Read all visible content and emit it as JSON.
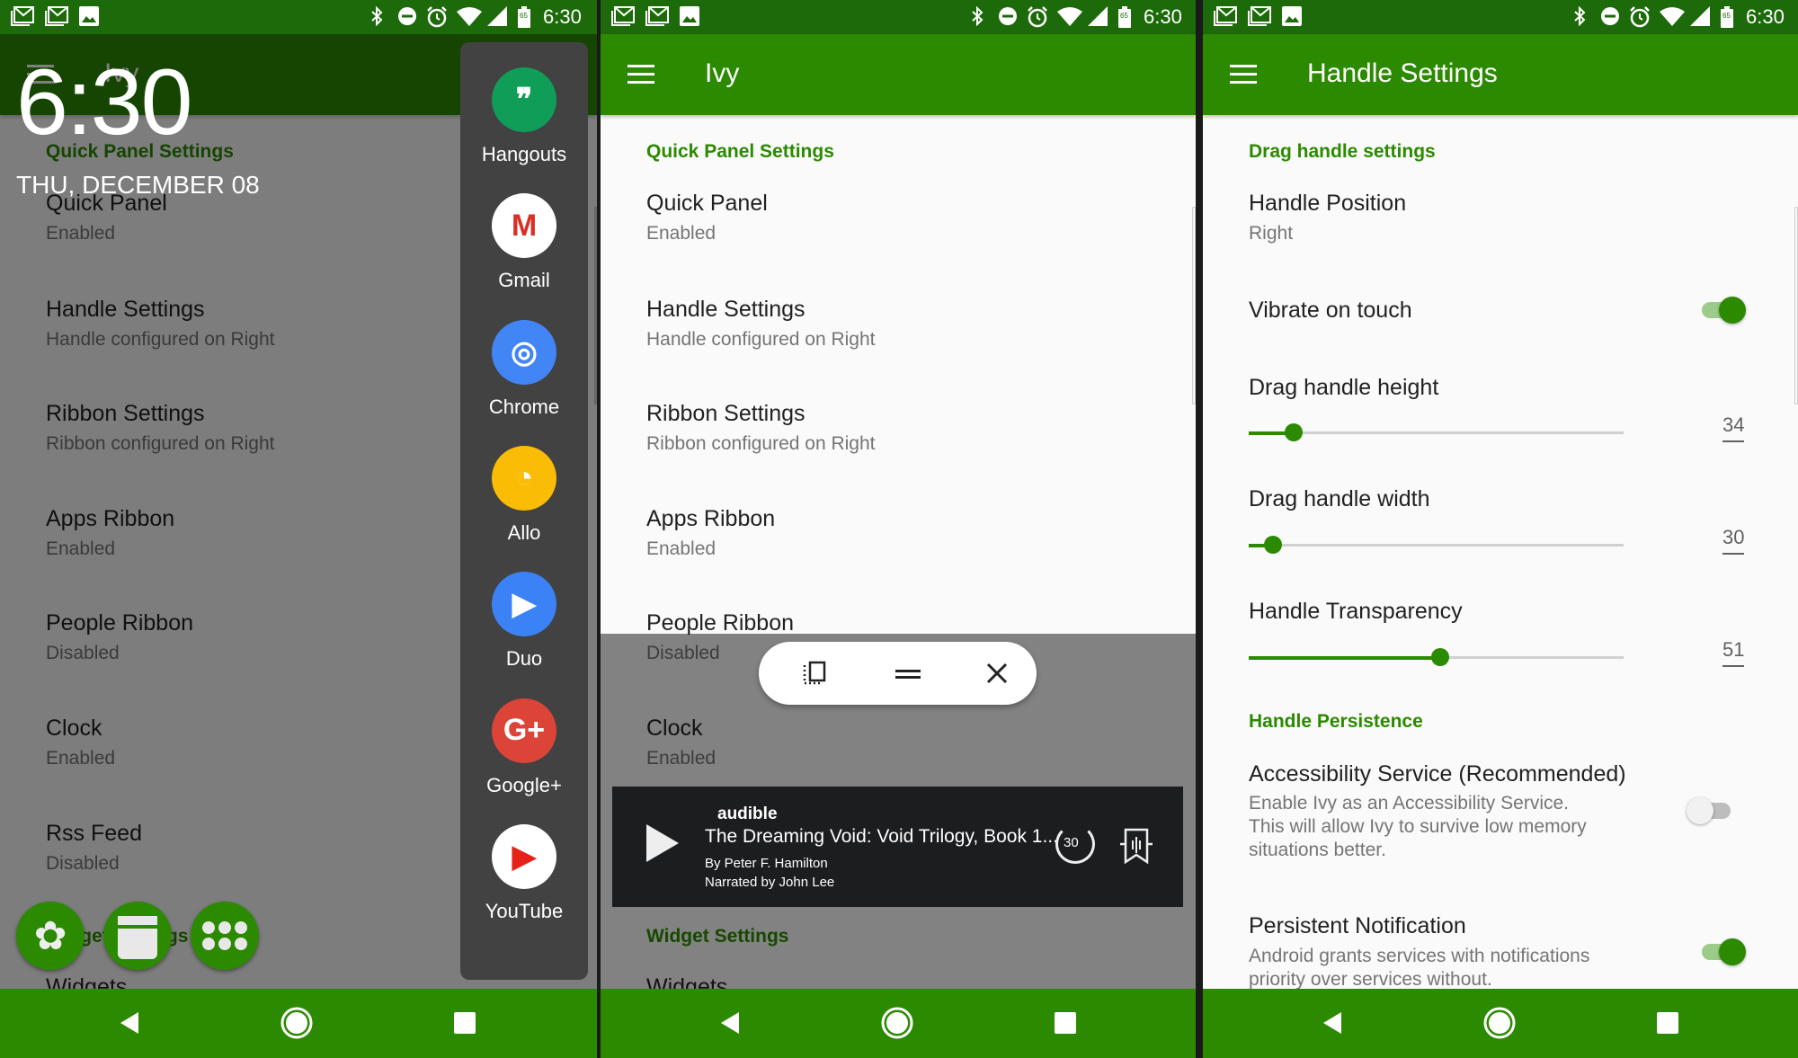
{
  "status_bar": {
    "time": "6:30",
    "battery_level": "65",
    "left_icons": [
      "gmail-icon",
      "gmail-icon",
      "image-icon"
    ],
    "right_icons": [
      "bluetooth-icon",
      "do-not-disturb-icon",
      "alarm-icon",
      "wifi-icon",
      "signal-icon",
      "battery-icon"
    ]
  },
  "colors": {
    "primary": "#2b8a00",
    "status_bar": "#1d6a0a",
    "accent_text": "#2b8a00"
  },
  "app": {
    "title": "Ivy"
  },
  "main_list": {
    "header": "Quick Panel Settings",
    "items": [
      {
        "title": "Quick Panel",
        "subtitle": "Enabled"
      },
      {
        "title": "Handle Settings",
        "subtitle": "Handle configured on Right"
      },
      {
        "title": "Ribbon Settings",
        "subtitle": "Ribbon configured on Right"
      },
      {
        "title": "Apps Ribbon",
        "subtitle": "Enabled"
      },
      {
        "title": "People Ribbon",
        "subtitle": "Disabled"
      },
      {
        "title": "Clock",
        "subtitle": "Enabled"
      },
      {
        "title": "Rss Feed",
        "subtitle": "Disabled"
      }
    ],
    "header2": "Widget Settings",
    "item_widgets": "Widgets"
  },
  "panel1": {
    "clock_time": "6:30",
    "clock_date": "THU, DECEMBER 08",
    "dock_apps": [
      {
        "label": "Hangouts",
        "icon": "hangouts-icon",
        "color": "#0f9d58"
      },
      {
        "label": "Gmail",
        "icon": "gmail-icon",
        "color": "#ffffff"
      },
      {
        "label": "Chrome",
        "icon": "chrome-icon",
        "color": "#4285f4"
      },
      {
        "label": "Allo",
        "icon": "allo-icon",
        "color": "#fbbc05"
      },
      {
        "label": "Duo",
        "icon": "duo-icon",
        "color": "#3b82f6"
      },
      {
        "label": "Google+",
        "icon": "google-plus-icon",
        "color": "#db4437"
      },
      {
        "label": "YouTube",
        "icon": "youtube-icon",
        "color": "#ffffff"
      }
    ],
    "bubbles": [
      "ivy-leaf-icon",
      "window-icon",
      "apps-grid-icon"
    ]
  },
  "panel2": {
    "pill_icons": [
      "screen-rotate-icon",
      "drag-handle-icon",
      "close-icon"
    ],
    "notification": {
      "app": "audible",
      "title": "The Dreaming Void: Void Trilogy, Book 1...",
      "author": "By Peter F. Hamilton",
      "narrator": "Narrated by John Lee",
      "replay_label": "30"
    }
  },
  "handle_settings": {
    "title": "Handle Settings",
    "section1": "Drag handle settings",
    "position_title": "Handle Position",
    "position_value": "Right",
    "vibrate_title": "Vibrate on touch",
    "vibrate_on": true,
    "sliders": [
      {
        "label": "Drag handle height",
        "value": "34",
        "fill_percent": 12
      },
      {
        "label": "Drag handle width",
        "value": "30",
        "fill_percent": 6.5
      },
      {
        "label": "Handle Transparency",
        "value": "51",
        "fill_percent": 51
      }
    ],
    "section2": "Handle Persistence",
    "accessibility_title": "Accessibility Service (Recommended)",
    "accessibility_desc": [
      "Enable Ivy as an Accessibility Service.",
      "This will allow Ivy to survive low memory",
      "situations better."
    ],
    "accessibility_on": false,
    "persistent_title": "Persistent Notification",
    "persistent_desc": [
      "Android grants services with notifications",
      "priority over services without."
    ],
    "persistent_on": true
  }
}
